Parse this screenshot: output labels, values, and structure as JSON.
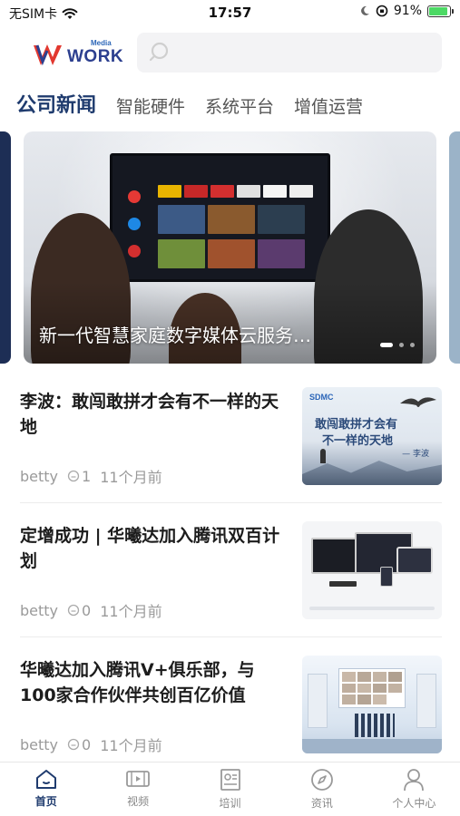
{
  "status_bar": {
    "carrier": "无SIM卡",
    "time": "17:57",
    "battery_percent": "91%",
    "battery_level": 0.91,
    "icons": [
      "wifi-icon",
      "moon-icon",
      "orientation-lock-icon",
      "battery-charging-icon"
    ]
  },
  "header": {
    "logo_text": "WORK",
    "logo_sub": "Media",
    "search_placeholder": ""
  },
  "tabs": [
    {
      "label": "公司新闻",
      "active": true
    },
    {
      "label": "智能硬件",
      "active": false
    },
    {
      "label": "系统平台",
      "active": false
    },
    {
      "label": "增值运营",
      "active": false
    }
  ],
  "carousel": {
    "caption": "新一代智慧家庭数字媒体云服务…",
    "slide_count": 3,
    "active_index": 0
  },
  "news": [
    {
      "title": "李波：敢闯敢拼才会有不一样的天地",
      "author": "betty",
      "comments": "1",
      "time": "11个月前",
      "thumb": {
        "brand": "SDMC",
        "line1": "敢闯敢拼才会有",
        "line2": "不一样的天地",
        "signature": "— 李波"
      }
    },
    {
      "title": "定增成功 | 华曦达加入腾讯双百计划",
      "author": "betty",
      "comments": "0",
      "time": "11个月前",
      "thumb": {}
    },
    {
      "title": "华曦达加入腾讯V+俱乐部，与100家合作伙伴共创百亿价值",
      "author": "betty",
      "comments": "0",
      "time": "11个月前",
      "thumb": {}
    }
  ],
  "tabbar": [
    {
      "label": "首页",
      "icon": "home-icon",
      "active": true
    },
    {
      "label": "视频",
      "icon": "video-icon",
      "active": false
    },
    {
      "label": "培训",
      "icon": "training-icon",
      "active": false
    },
    {
      "label": "资讯",
      "icon": "compass-icon",
      "active": false
    },
    {
      "label": "个人中心",
      "icon": "person-icon",
      "active": false
    }
  ],
  "colors": {
    "accent": "#1f3b6e",
    "brand_blue": "#2c66b8",
    "battery_green": "#4cd964"
  }
}
